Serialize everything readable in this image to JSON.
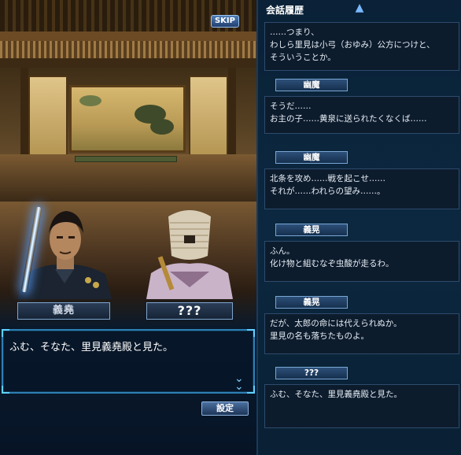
{
  "scene": {
    "skip_label": "SKIP",
    "left_character_name": "義堯",
    "right_character_name": "???",
    "message": "ふむ、そなた、里見義堯殿と見た。",
    "settings_label": "設定"
  },
  "history": {
    "title": "会話履歴",
    "entries": [
      {
        "speaker": "",
        "lines": [
          "……つまり、",
          "わしら里見は小弓（おゆみ）公方につけと、",
          "そういうことか。"
        ]
      },
      {
        "speaker": "幽魔",
        "lines": [
          "そうだ……",
          "お主の子……黄泉に送られたくなくば……"
        ]
      },
      {
        "speaker": "幽魔",
        "lines": [
          "北条を攻め……戦を起こせ……",
          "それが……われらの望み……。"
        ]
      },
      {
        "speaker": "義晃",
        "lines": [
          "ふん。",
          "化け物と組むなぞ虫酸が走るわ。"
        ]
      },
      {
        "speaker": "義晃",
        "lines": [
          "だが、太郎の命には代えられぬか。",
          "里見の名も落ちたものよ。"
        ]
      },
      {
        "speaker": "???",
        "lines": [
          "ふむ、そなた、里見義堯殿と見た。"
        ]
      }
    ]
  },
  "colors": {
    "accent": "#2e7fb3",
    "panel_bg": "#0d1c2d",
    "nameplate_border": "#79a7d4"
  },
  "icons": {
    "scroll_up": "up-arrow-icon",
    "advance": "double-chevron-down-icon"
  }
}
